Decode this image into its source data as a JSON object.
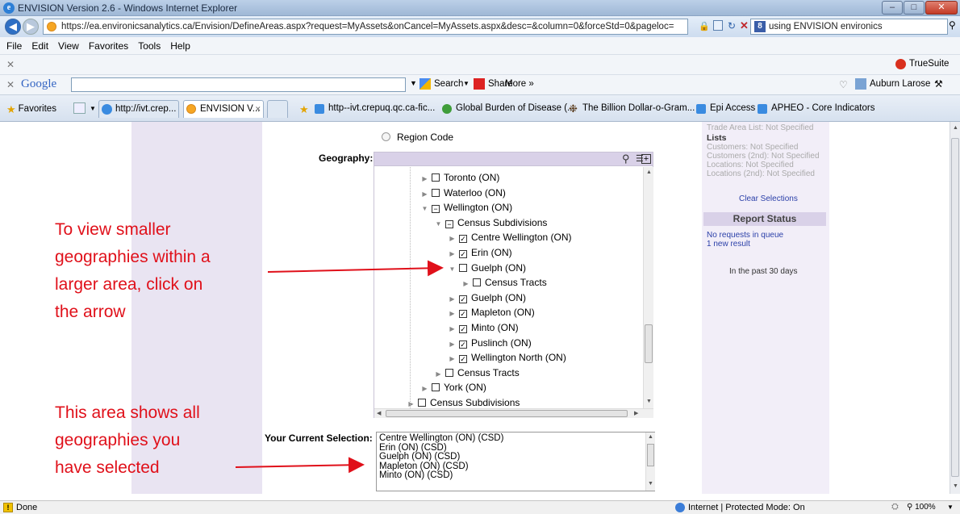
{
  "window": {
    "title": "ENVISION Version 2.6 - Windows Internet Explorer"
  },
  "address": {
    "url": "https://ea.environicsanalytics.ca/Envision/DefineAreas.aspx?request=MyAssets&onCancel=MyAssets.aspx&desc=&column=0&forceStd=0&pageloc=",
    "search": "using ENVISION environics"
  },
  "menu": [
    "File",
    "Edit",
    "View",
    "Favorites",
    "Tools",
    "Help"
  ],
  "toolbar": {
    "truesuite": "TrueSuite",
    "google": "Google",
    "search_btn": "Search",
    "share_btn": "Share",
    "more_btn": "More »",
    "user": "Auburn Larose"
  },
  "favorites": {
    "label": "Favorites",
    "tabs": [
      "http://ivt.crep...",
      "ENVISION V..."
    ],
    "links": [
      "http--ivt.crepuq.qc.ca-fic...",
      "Global Burden of Disease (...",
      "The Billion Dollar-o-Gram...",
      "Epi Access",
      "APHEO - Core Indicators"
    ]
  },
  "form": {
    "region_code": "Region Code",
    "geography_label": "Geography:",
    "current_selection_label": "Your Current Selection:",
    "tree": [
      {
        "label": "Toronto (ON)",
        "level": 0,
        "expanded": false,
        "checked": false
      },
      {
        "label": "Waterloo (ON)",
        "level": 0,
        "expanded": false,
        "checked": false
      },
      {
        "label": "Wellington (ON)",
        "level": 0,
        "expanded": true,
        "checked": "partial"
      },
      {
        "label": "Census Subdivisions",
        "level": 1,
        "expanded": true,
        "checked": "partial"
      },
      {
        "label": "Centre Wellington (ON)",
        "level": 2,
        "expanded": false,
        "checked": true
      },
      {
        "label": "Erin (ON)",
        "level": 2,
        "expanded": false,
        "checked": true
      },
      {
        "label": "Guelph (ON)",
        "level": 2,
        "expanded": true,
        "checked": false
      },
      {
        "label": "Census Tracts",
        "level": 3,
        "expanded": false,
        "checked": false
      },
      {
        "label": "Guelph (ON)",
        "level": 2,
        "expanded": false,
        "checked": true
      },
      {
        "label": "Mapleton (ON)",
        "level": 2,
        "expanded": false,
        "checked": true
      },
      {
        "label": "Minto (ON)",
        "level": 2,
        "expanded": false,
        "checked": true
      },
      {
        "label": "Puslinch (ON)",
        "level": 2,
        "expanded": false,
        "checked": true
      },
      {
        "label": "Wellington North (ON)",
        "level": 2,
        "expanded": false,
        "checked": true
      },
      {
        "label": "Census Tracts",
        "level": 1,
        "expanded": false,
        "checked": false
      },
      {
        "label": "York (ON)",
        "level": 0,
        "expanded": false,
        "checked": false
      },
      {
        "label": "Census Subdivisions",
        "level": -1,
        "expanded": false,
        "checked": false
      }
    ],
    "selection": [
      "Centre Wellington (ON) (CSD)",
      "Erin (ON) (CSD)",
      "Guelph (ON) (CSD)",
      "Mapleton (ON) (CSD)",
      "Minto (ON) (CSD)"
    ]
  },
  "sidebar": {
    "trade_area_list": "Trade Area List:",
    "not_specified": "Not Specified",
    "lists_title": "Lists",
    "lists": [
      "Customers:",
      "Customers (2nd):",
      "Locations:",
      "Locations (2nd):"
    ],
    "clear": "Clear Selections",
    "report_status_title": "Report Status",
    "no_requests": "No requests in queue",
    "new_result": "1 new result",
    "past_30": "In the past 30 days"
  },
  "annotations": {
    "arrow_note": [
      "To view smaller",
      "geographies within a",
      "larger area, click on",
      "the arrow"
    ],
    "selection_note": [
      "This area shows all",
      "geographies you",
      "have selected"
    ]
  },
  "status": {
    "left": "Done",
    "zone": "Internet | Protected Mode: On",
    "zoom": "100%"
  }
}
